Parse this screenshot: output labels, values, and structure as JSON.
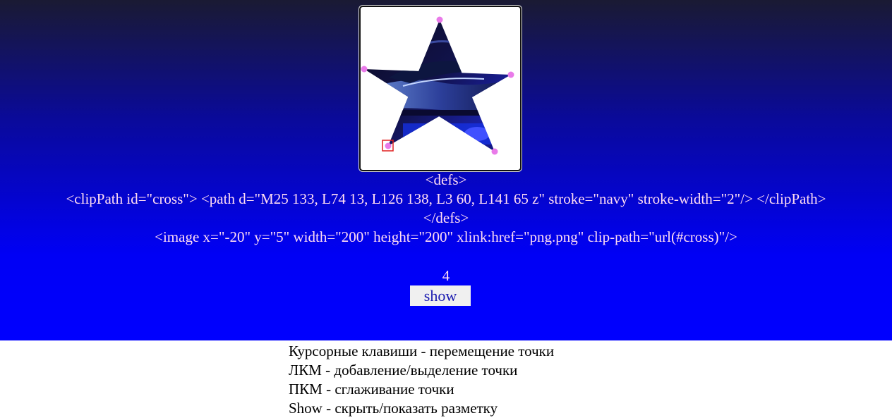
{
  "editor": {
    "code_lines": [
      "<defs>",
      "<clipPath id=\"cross\"> <path d=\"M25 133, L74 13, L126 138, L3 60, L141 65 z\" stroke=\"navy\" stroke-width=\"2\"/> </clipPath>",
      "</defs>",
      "<image x=\"-20\" y=\"5\" width=\"200\" height=\"200\" xlink:href=\"png.png\" clip-path=\"url(#cross)\"/>"
    ],
    "selected_point_index": "4",
    "show_label": "show"
  },
  "help": {
    "lines": [
      "Курсорные клавиши - перемещение точки",
      "ЛКМ - добавление/выделение точки",
      "ПКМ - сглаживание точки",
      "Show - скрыть/показать разметку"
    ]
  },
  "colors": {
    "point_handle": "#e97ae9",
    "selection_box": "#e02020",
    "background_top": "#1a1a33",
    "background_bottom": "#0000ff"
  }
}
